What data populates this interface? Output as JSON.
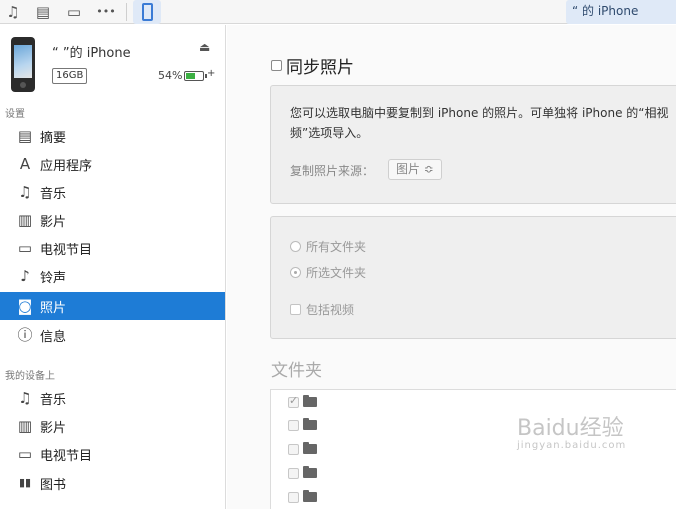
{
  "toolbar": {
    "icons": [
      "music-note-icon",
      "film-icon",
      "tv-icon",
      "more-icon",
      "iphone-icon"
    ],
    "music_glyph": "♫",
    "film_glyph": "▤",
    "tv_glyph": "▭",
    "more_glyph": "•••",
    "window_title": "“      的 iPhone"
  },
  "device": {
    "name": "“      ”的 iPhone",
    "capacity": "16GB",
    "battery_percent": "54%",
    "battery_level": 0.54,
    "eject_glyph": "⏏",
    "charge_glyph": "+"
  },
  "sidebar": {
    "settings_label": "设置",
    "settings_items": [
      {
        "label": "摘要",
        "icon": "summary-icon",
        "glyph": "▤"
      },
      {
        "label": "应用程序",
        "icon": "apps-icon",
        "glyph": "A"
      },
      {
        "label": "音乐",
        "icon": "music-icon",
        "glyph": "♫"
      },
      {
        "label": "影片",
        "icon": "movies-icon",
        "glyph": "▥"
      },
      {
        "label": "电视节目",
        "icon": "tv-shows-icon",
        "glyph": "▭"
      },
      {
        "label": "铃声",
        "icon": "bell-icon",
        "glyph": "♪"
      },
      {
        "label": "照片",
        "icon": "camera-icon",
        "glyph": "◙"
      },
      {
        "label": "信息",
        "icon": "info-icon",
        "glyph": "ⓘ"
      }
    ],
    "on_device_label": "我的设备上",
    "on_device_items": [
      {
        "label": "音乐",
        "icon": "music-icon",
        "glyph": "♫"
      },
      {
        "label": "影片",
        "icon": "movies-icon",
        "glyph": "▥"
      },
      {
        "label": "电视节目",
        "icon": "tv-shows-icon",
        "glyph": "▭"
      },
      {
        "label": "图书",
        "icon": "books-icon",
        "glyph": "▮▮"
      }
    ]
  },
  "main": {
    "sync_label": "同步照片",
    "description": "您可以选取电脑中要复制到 iPhone 的照片。可单独将 iPhone 的“相视频”选项导入。",
    "source_label": "复制照片来源：",
    "source_value": "图片 ≎",
    "options": {
      "all_folders": "所有文件夹",
      "selected_folders": "所选文件夹",
      "include_videos": "包括视频"
    },
    "folders_title": "文件夹",
    "folder_rows": [
      {
        "checked": true
      },
      {
        "checked": false
      },
      {
        "checked": false
      },
      {
        "checked": false
      },
      {
        "checked": false
      }
    ],
    "watermark": "Baidu经验",
    "watermark_sub": "jingyan.baidu.com"
  },
  "colors": {
    "accent": "#1e7cd6",
    "toolbar_selected": "#dfe9f7",
    "battery_green": "#3cb043"
  }
}
